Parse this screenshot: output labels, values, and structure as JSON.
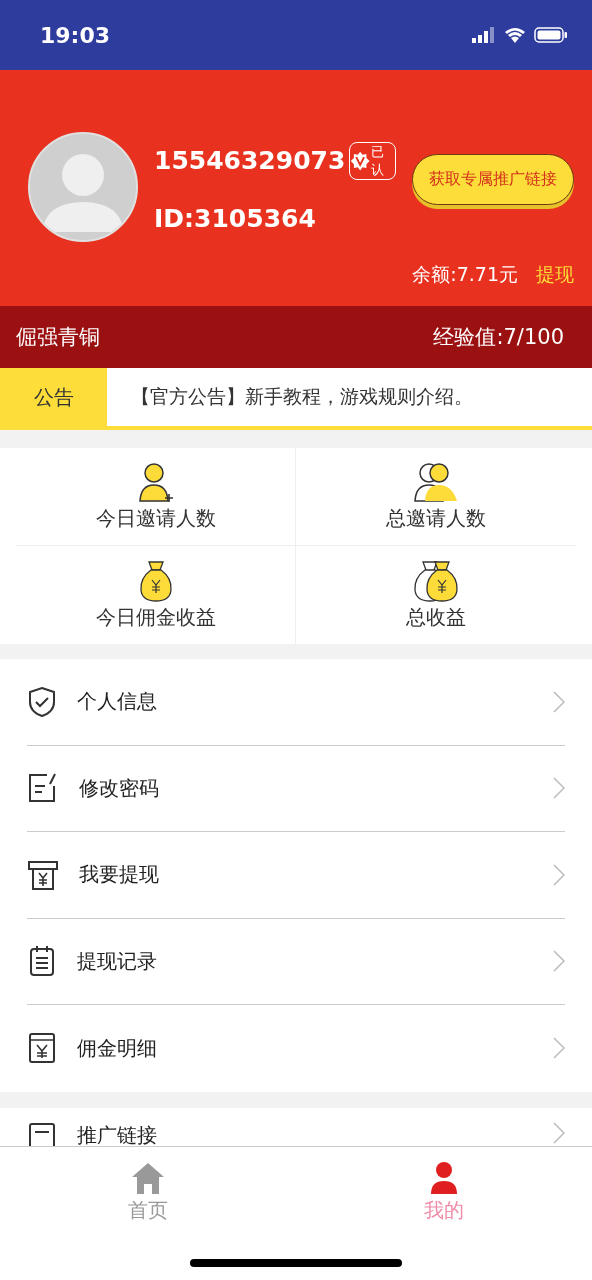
{
  "status_bar": {
    "time": "19:03"
  },
  "profile": {
    "phone": "15546329073",
    "badge": "已认",
    "id": "ID:3105364",
    "promo_button": "获取专属推广链接",
    "balance": "余额:7.71元",
    "withdraw_link": "提现"
  },
  "level_bar": {
    "rank": "倔强青铜",
    "experience": "经验值:7/100"
  },
  "notice": {
    "label": "公告",
    "text": "【官方公告】新手教程，游戏规则介绍。"
  },
  "stats": [
    {
      "kind": "invite-today",
      "label": "今日邀请人数"
    },
    {
      "kind": "invite-total",
      "label": "总邀请人数"
    },
    {
      "kind": "money-today",
      "label": "今日佣金收益"
    },
    {
      "kind": "money-total",
      "label": "总收益"
    }
  ],
  "menu": [
    {
      "kind": "shield",
      "label": "个人信息"
    },
    {
      "kind": "edit",
      "label": "修改密码"
    },
    {
      "kind": "withdraw",
      "label": "我要提现"
    },
    {
      "kind": "record",
      "label": "提现记录"
    },
    {
      "kind": "wallet",
      "label": "佣金明细"
    }
  ],
  "menu2": [
    {
      "kind": "link",
      "label": "推广链接"
    }
  ],
  "tab_bar": [
    {
      "kind": "home",
      "label": "首页",
      "selected": false
    },
    {
      "kind": "user",
      "label": "我的",
      "selected": true
    }
  ]
}
